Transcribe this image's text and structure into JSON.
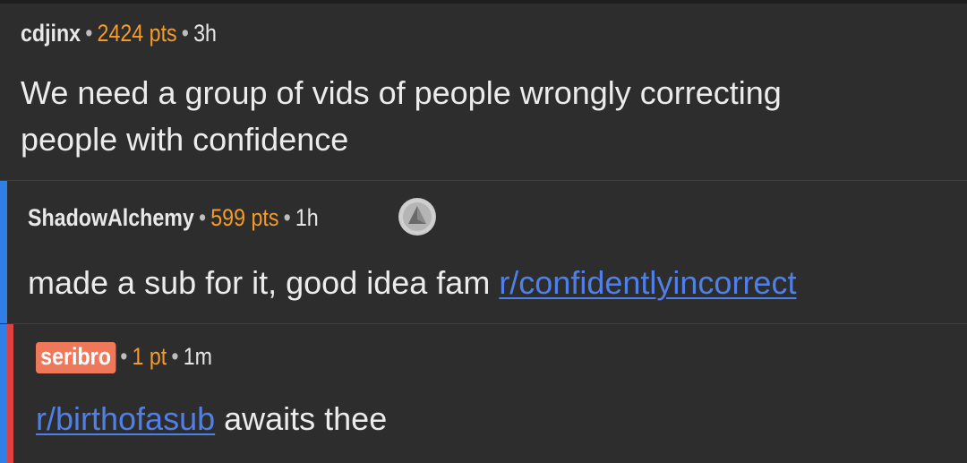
{
  "comments": [
    {
      "author": "cdjinx",
      "points": "2424 pts",
      "time": "3h",
      "body": "We need a group of vids of people wrongly correcting",
      "body_line2": "people with confidence"
    },
    {
      "author": "ShadowAlchemy",
      "points": "599 pts",
      "time": "1h",
      "body_prefix": "made a sub for it, good idea fam ",
      "body_link": "r/confidentlyincorrect",
      "award_icon": "silver-award-icon"
    },
    {
      "author": "seribro",
      "points": "1 pt",
      "time": "1m",
      "body_link": "r/birthofasub",
      "body_suffix": " awaits thee"
    }
  ],
  "separator": "•",
  "colors": {
    "background": "#2d2d2d",
    "points": "#f59b2b",
    "link": "#4f7fe8",
    "depth1_bar": "#2f7fe6",
    "depth2_bar": "#e04040",
    "op_badge": "#f0785a"
  }
}
